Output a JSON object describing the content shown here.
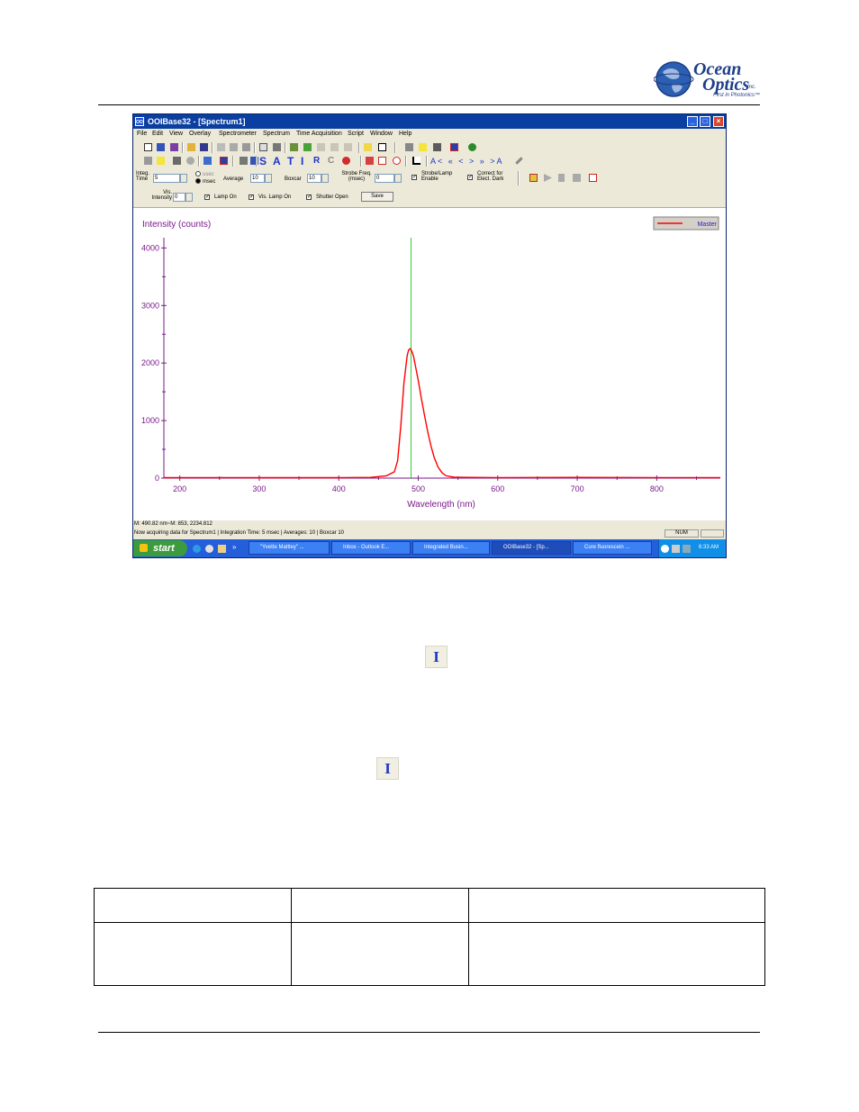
{
  "logo": {
    "line1": "Ocean",
    "line2": "Optics",
    "inc": "Inc.",
    "tagline": "First in Photonics™"
  },
  "window": {
    "title": "OOIBase32 - [Spectrum1]",
    "app_icon": "OOI",
    "buttons": {
      "minimize": "_",
      "maximize": "□",
      "close": "×"
    }
  },
  "menu": [
    "File",
    "Edit",
    "View",
    "Overlay",
    "Spectrometer",
    "Spectrum",
    "Time Acquisition",
    "Script",
    "Window",
    "Help"
  ],
  "toolbar_text": {
    "s": "S",
    "a": "A",
    "t": "T",
    "i": "I",
    "r": "R",
    "c": "C",
    "nav": "A< « < > » >A"
  },
  "acq": {
    "integ_label": "Integ. Time",
    "integ_value": "5",
    "usec": "usec",
    "msec": "msec",
    "average_label": "Average",
    "average_value": "10",
    "boxcar_label": "Boxcar",
    "boxcar_value": "10",
    "strobe_freq_label": "Strobe Freq. (msec)",
    "strobe_freq_value": "0",
    "strobe_enable_label": "Strobe/Lamp Enable",
    "correct_dark_label": "Correct for Elect. Dark"
  },
  "lamp": {
    "vis_intensity_label": "Vis. Intensity",
    "vis_intensity_value": "0",
    "lamp_on": "Lamp On",
    "vis_lamp_on": "Vis. Lamp On",
    "shutter_open": "Shutter Open",
    "save": "Save"
  },
  "chart_data": {
    "type": "line",
    "ylabel": "Intensity (counts)",
    "xlabel": "Wavelength (nm)",
    "xlim": [
      180,
      880
    ],
    "ylim": [
      0,
      4100
    ],
    "xticks": [
      200,
      300,
      400,
      500,
      600,
      700,
      800
    ],
    "yticks": [
      0,
      1000,
      2000,
      3000,
      4000
    ],
    "legend": "top-right",
    "cursor_x": 490.82,
    "series": [
      {
        "name": "Master",
        "color": "#ff0000",
        "x": [
          180,
          200,
          300,
          400,
          440,
          460,
          470,
          474,
          478,
          482,
          486,
          488,
          490,
          492,
          494,
          496,
          500,
          504,
          508,
          512,
          516,
          520,
          525,
          530,
          535,
          545,
          600,
          700,
          800,
          880
        ],
        "y": [
          8,
          10,
          8,
          8,
          12,
          40,
          110,
          300,
          900,
          1650,
          2130,
          2230,
          2250,
          2200,
          2120,
          1980,
          1700,
          1380,
          1080,
          800,
          560,
          360,
          190,
          90,
          40,
          15,
          10,
          12,
          10,
          8
        ]
      }
    ],
    "cursor_color": "#00c000"
  },
  "status": {
    "cursor": "M: 490.82 nm~M: 853, 2234.812",
    "acquiring": "Now acquiring data for Spectrum1 | Integration Time: 5 msec | Averages: 10 | Boxcar 10",
    "num": "NUM"
  },
  "taskbar": {
    "start": "start",
    "more": "»",
    "tasks": [
      "\"Yvette Mattley\" ...",
      "Inbox - Outlook E...",
      "Integrated Busin...",
      "OOIBase32 - [Sp...",
      "Cure fluorescein ..."
    ],
    "clock": "6:33 AM"
  },
  "icons": {
    "integral_button": "I"
  }
}
